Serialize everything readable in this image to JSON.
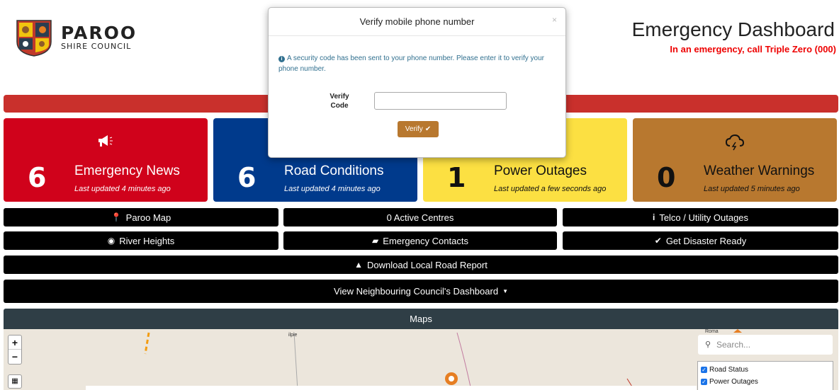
{
  "header": {
    "logo_main": "PAROO",
    "logo_sub": "SHIRE COUNCIL",
    "title": "Emergency Dashboard",
    "subtitle": "In an emergency, call Triple Zero (000)"
  },
  "tiles": [
    {
      "count": "6",
      "label": "Emergency News",
      "updated": "Last updated 4 minutes ago",
      "icon": "megaphone-icon"
    },
    {
      "count": "6",
      "label": "Road Conditions",
      "updated": "Last updated 4 minutes ago",
      "icon": "road-icon"
    },
    {
      "count": "1",
      "label": "Power Outages",
      "updated": "Last updated a few seconds ago",
      "icon": "power-icon"
    },
    {
      "count": "0",
      "label": "Weather Warnings",
      "updated": "Last updated 5 minutes ago",
      "icon": "storm-cloud-icon"
    }
  ],
  "colors": {
    "red_tile": "#d0021b",
    "blue_tile": "#003a8c",
    "yellow_tile": "#fce042",
    "brown_tile": "#b8782f",
    "alert_bar": "#c9302c",
    "maps_header": "#2f3e46"
  },
  "buttons": {
    "paroo_map": "Paroo Map",
    "active_centres": "0 Active Centres",
    "telco": "Telco / Utility Outages",
    "river_heights": "River Heights",
    "emergency_contacts": "Emergency Contacts",
    "disaster_ready": "Get Disaster Ready",
    "road_report": "Download Local Road Report",
    "neighbouring": "View Neighbouring Council's Dashboard"
  },
  "maps": {
    "heading": "Maps",
    "search_placeholder": "Search...",
    "layers": [
      "Road Status",
      "Power Outages"
    ],
    "labels": {
      "place1": "ilpie",
      "place2": "Roma"
    }
  },
  "modal": {
    "title": "Verify mobile phone number",
    "close": "×",
    "info": "A security code has been sent to your phone number. Please enter it to verify your phone number.",
    "field_label_1": "Verify",
    "field_label_2": "Code",
    "field_value": "",
    "button": "Verify"
  }
}
